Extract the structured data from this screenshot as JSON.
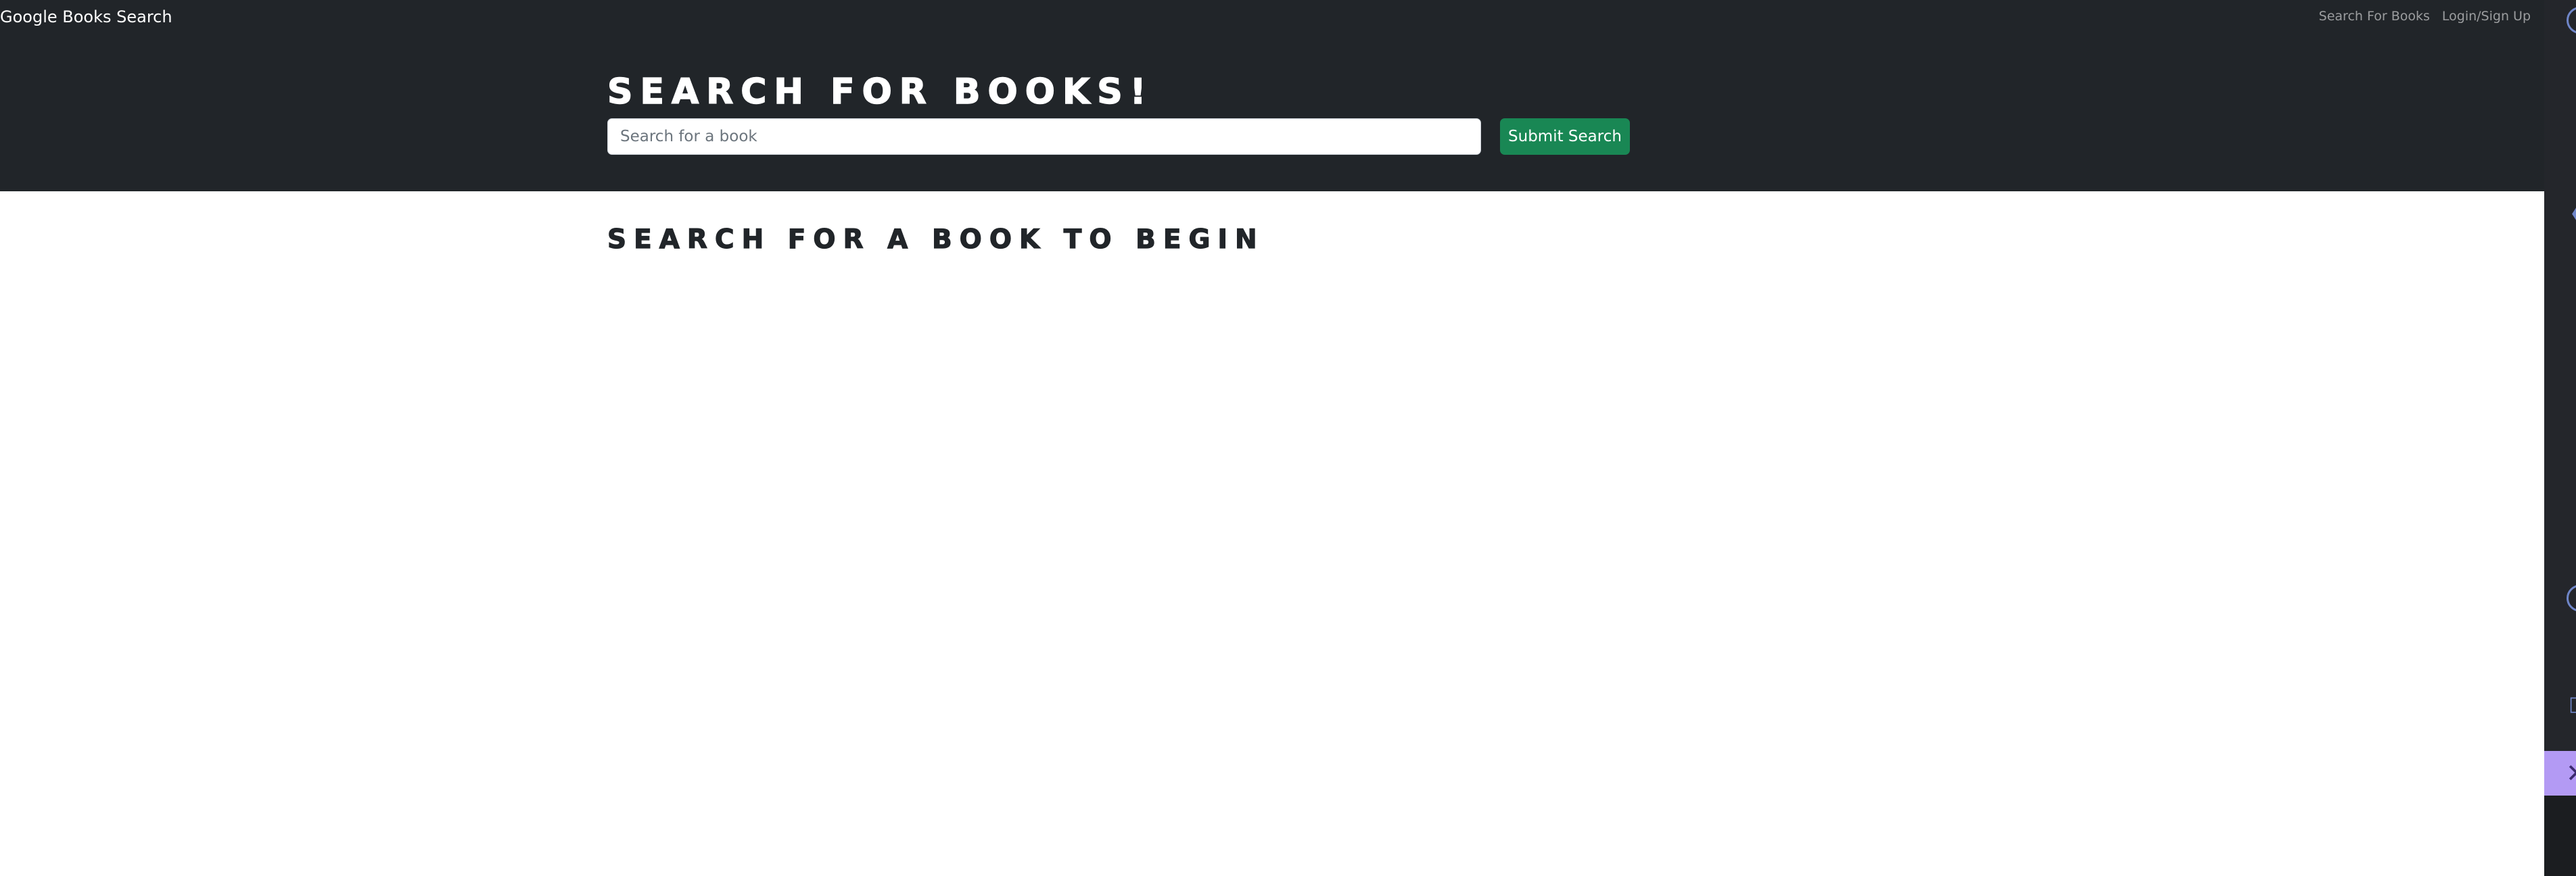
{
  "navbar": {
    "brand": "Google Books Search",
    "links": [
      {
        "label": "Search For Books"
      },
      {
        "label": "Login/Sign Up"
      }
    ]
  },
  "hero": {
    "title": "Search for Books!",
    "search_placeholder": "Search for a book",
    "search_value": "",
    "submit_label": "Submit Search"
  },
  "results": {
    "title": "Search for a book to begin"
  },
  "side_panel": {
    "icons": [
      "account-circle-icon",
      "collapse-chevron-icon",
      "account-circle-icon",
      "panel-icon",
      "close-icon"
    ]
  },
  "colors": {
    "header_bg": "#212529",
    "submit_bg": "#198754",
    "side_panel_bg": "#24262b",
    "side_accent": "#b39af4"
  }
}
